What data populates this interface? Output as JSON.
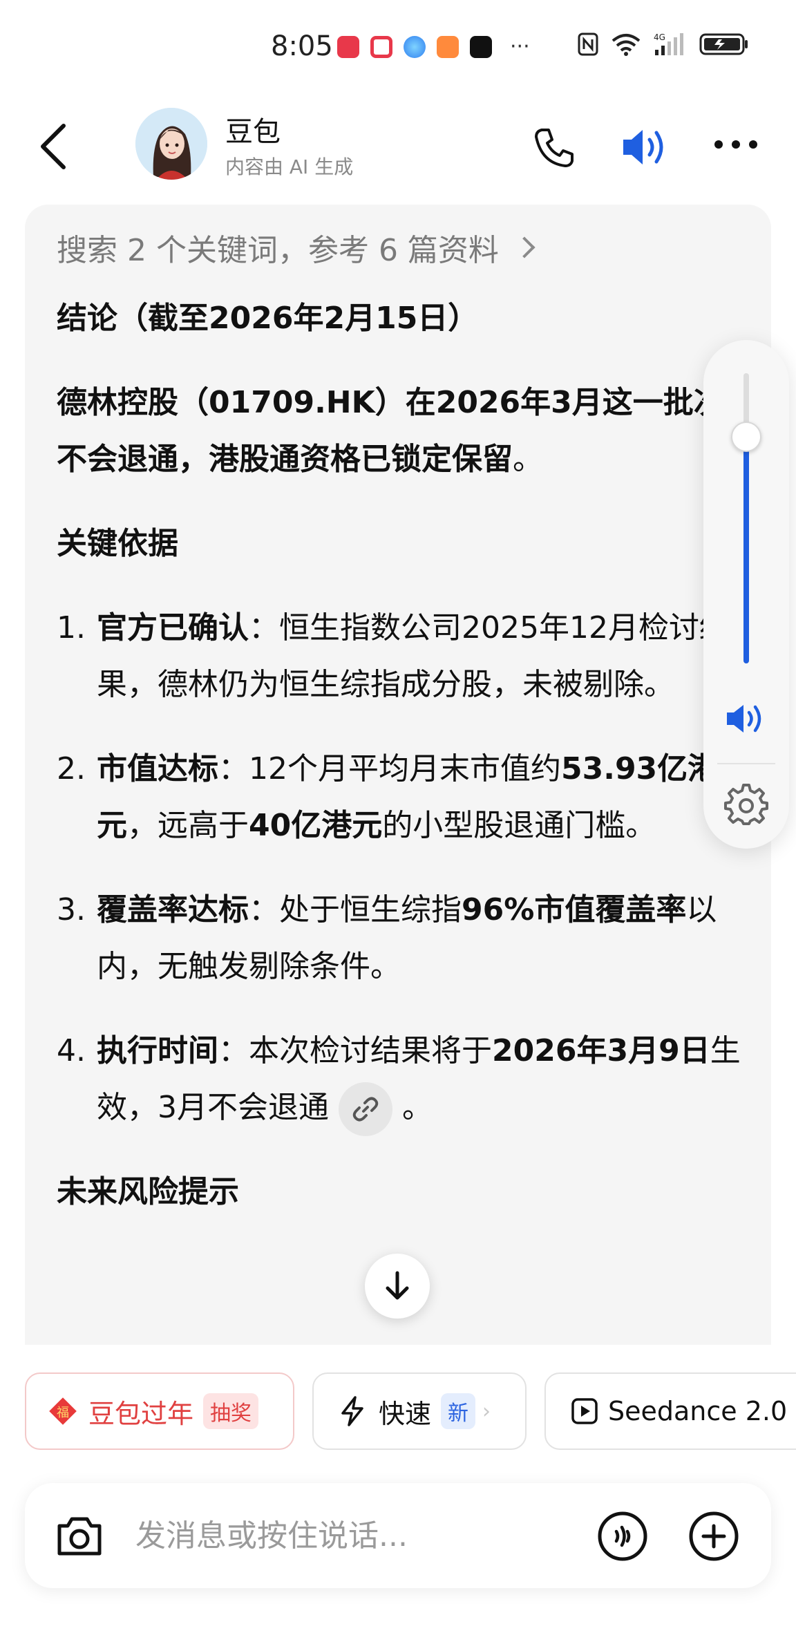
{
  "status_bar": {
    "time": "8:05",
    "more": "···",
    "app_icons": [
      "huawei-app-icon",
      "red-app-icon",
      "blue-app-icon",
      "orange-app-icon",
      "dark-app-icon"
    ],
    "right_icons": [
      "nfc-icon",
      "wifi-icon",
      "cellular-4g-icon",
      "battery-icon"
    ]
  },
  "header": {
    "name": "豆包",
    "subtitle": "内容由 AI 生成",
    "colors": {
      "accent": "#1f5fe0"
    }
  },
  "message": {
    "search_ref": "搜索 2 个关键词，参考 6 篇资料",
    "conclusion_title": "结论（截至2026年2月15日）",
    "conclusion": {
      "bold_part": "德林控股（01709.HK）在2026年3月这一批次不会退通，港股通资格已锁定保留",
      "end": "。"
    },
    "basis_heading": "关键依据",
    "items": [
      {
        "num": "1.",
        "label": "官方已确认",
        "sep": "：",
        "text": "恒生指数公司2025年12月检讨结果，德林仍为恒生综指成分股，未被剔除。"
      },
      {
        "num": "2.",
        "label": "市值达标",
        "sep": "：",
        "t1": "12个月平均月末市值约",
        "b1": "53.93亿港元",
        "t2": "，远高于",
        "b2": "40亿港元",
        "t3": "的小型股退通门槛。"
      },
      {
        "num": "3.",
        "label": "覆盖率达标",
        "sep": "：",
        "t1": "处于恒生综指",
        "b1": "96%市值覆盖率",
        "t2": "以内，无触发剔除条件。"
      },
      {
        "num": "4.",
        "label": "执行时间",
        "sep": "：",
        "t1": "本次检讨结果将于",
        "b1": "2026年3月9日",
        "t2": "生效，3月不会退通",
        "t3": "。"
      }
    ],
    "risk_heading": "未来风险提示"
  },
  "volume": {
    "level": 0.78
  },
  "chips": {
    "festival": {
      "icon_text": "福",
      "label": "豆包过年",
      "tag": "抽奖"
    },
    "fast": {
      "label": "快速",
      "tag": "新",
      "arrow": "›"
    },
    "seedance": {
      "label": "Seedance 2.0"
    }
  },
  "input": {
    "placeholder": "发消息或按住说话...",
    "value": ""
  }
}
